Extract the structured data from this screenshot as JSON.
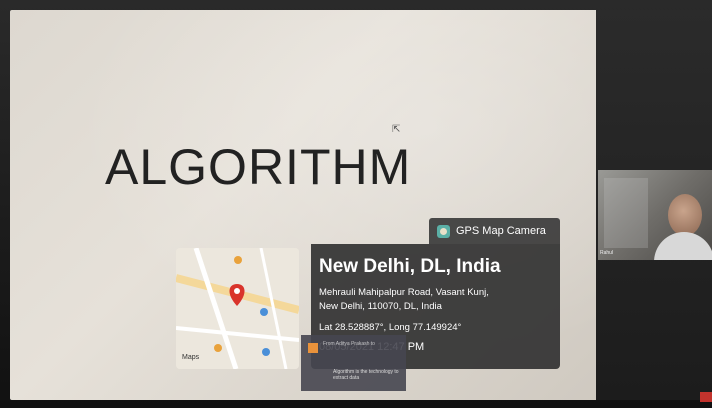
{
  "slide": {
    "title": "ALGORITHM"
  },
  "gps_camera": {
    "app_label": "GPS Map Camera",
    "city": "New Delhi, DL, India",
    "address_line1": "Mehrauli Mahipalpur Road, Vasant Kunj,",
    "address_line2": "New Delhi, 110070, DL, India",
    "coordinates": "Lat 28.528887°, Long 77.149924°",
    "datetime": "08/05/2021 12:47 PM"
  },
  "map": {
    "logo_text": "Maps",
    "pin_color": "#d9342b"
  },
  "chat": {
    "from": "From Aditya Prakash to",
    "message": "Algorithm is the technology to extract data"
  },
  "participant": {
    "name": "Rahul"
  }
}
